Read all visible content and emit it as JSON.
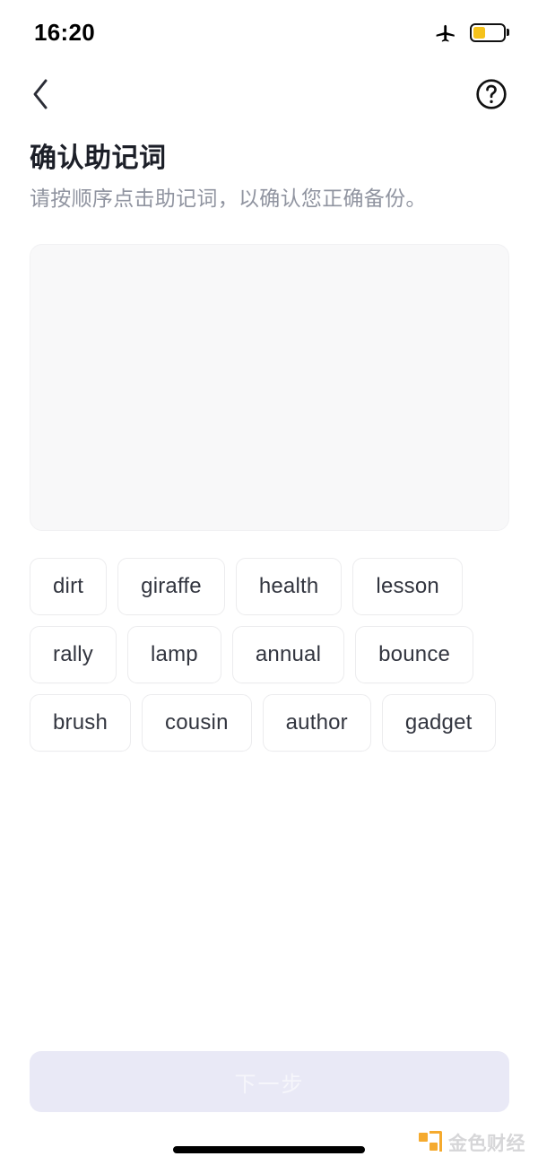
{
  "status_bar": {
    "time": "16:20",
    "airplane_icon": "airplane-mode-icon",
    "battery_icon": "battery-icon",
    "battery_level_percent": 42,
    "battery_color": "#F5C21B"
  },
  "nav_bar": {
    "back_icon": "chevron-left-icon",
    "help_icon": "question-circle-icon"
  },
  "header": {
    "title": "确认助记词",
    "subtitle": "请按顺序点击助记词，以确认您正确备份。"
  },
  "answer_panel": {
    "selected_words": [],
    "background_color": "#f8f8f9"
  },
  "word_pool": {
    "words": [
      "dirt",
      "giraffe",
      "health",
      "lesson",
      "rally",
      "lamp",
      "annual",
      "bounce",
      "brush",
      "cousin",
      "author",
      "gadget"
    ]
  },
  "footer": {
    "next_button_label": "下一步",
    "next_button_enabled": false,
    "next_button_color": "#e9e9f6"
  },
  "watermark": {
    "text": "金色财经",
    "accent_color": "#F5A623"
  }
}
